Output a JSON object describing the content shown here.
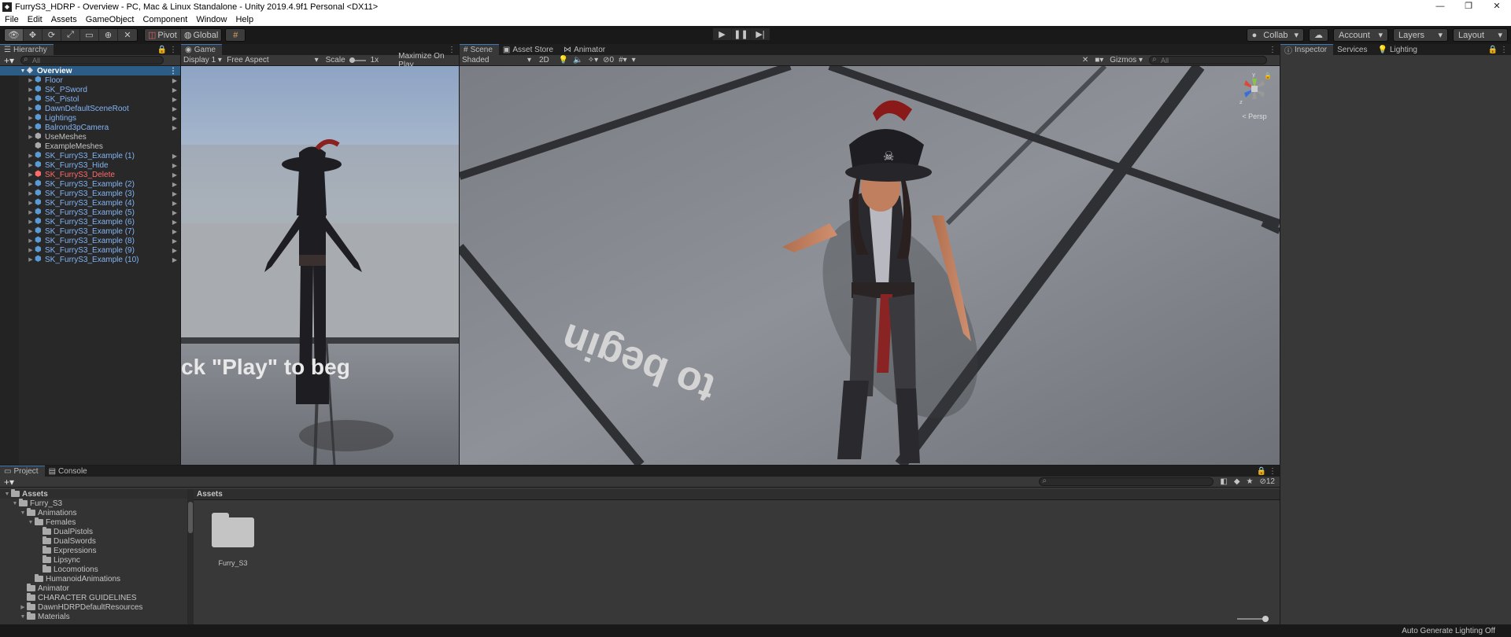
{
  "window": {
    "title": "FurryS3_HDRP - Overview - PC, Mac & Linux Standalone - Unity 2019.4.9f1 Personal <DX11>",
    "controls": [
      "—",
      "❐",
      "✕"
    ]
  },
  "menu": [
    "File",
    "Edit",
    "Assets",
    "GameObject",
    "Component",
    "Window",
    "Help"
  ],
  "toolbar": {
    "pivot": "Pivot",
    "global": "Global",
    "collab": "Collab",
    "account": "Account",
    "layers": "Layers",
    "layout": "Layout"
  },
  "hierarchy": {
    "tab": "Hierarchy",
    "search_placeholder": "All",
    "root": "Overview",
    "items": [
      {
        "label": "Floor",
        "style": "prefab"
      },
      {
        "label": "SK_PSword",
        "style": "prefab"
      },
      {
        "label": "SK_Pistol",
        "style": "prefab"
      },
      {
        "label": "DawnDefaultSceneRoot",
        "style": "prefab"
      },
      {
        "label": "Lightings",
        "style": "prefab"
      },
      {
        "label": "Balrond3pCamera",
        "style": "prefab"
      },
      {
        "label": "UseMeshes",
        "style": "plain"
      },
      {
        "label": "ExampleMeshes",
        "style": "plain"
      },
      {
        "label": "SK_FurryS3_Example (1)",
        "style": "prefab"
      },
      {
        "label": "SK_FurryS3_Hide",
        "style": "prefab"
      },
      {
        "label": "SK_FurryS3_Delete",
        "style": "red"
      },
      {
        "label": "SK_FurryS3_Example (2)",
        "style": "prefab"
      },
      {
        "label": "SK_FurryS3_Example (3)",
        "style": "prefab"
      },
      {
        "label": "SK_FurryS3_Example (4)",
        "style": "prefab"
      },
      {
        "label": "SK_FurryS3_Example (5)",
        "style": "prefab"
      },
      {
        "label": "SK_FurryS3_Example (6)",
        "style": "prefab"
      },
      {
        "label": "SK_FurryS3_Example (7)",
        "style": "prefab"
      },
      {
        "label": "SK_FurryS3_Example (8)",
        "style": "prefab"
      },
      {
        "label": "SK_FurryS3_Example (9)",
        "style": "prefab"
      },
      {
        "label": "SK_FurryS3_Example (10)",
        "style": "prefab"
      }
    ]
  },
  "game": {
    "tab": "Game",
    "display": "Display 1",
    "aspect": "Free Aspect",
    "scale_label": "Scale",
    "scale_value": "1x",
    "maximize": "Maximize On Play",
    "floor_text": "ck \"Play\" to beg"
  },
  "scene": {
    "tabs": [
      "Scene",
      "Asset Store",
      "Animator"
    ],
    "shading": "Shaded",
    "mode_2d": "2D",
    "hidden_count": "0",
    "gizmos": "Gizmos",
    "search_placeholder": "All",
    "persp": "< Persp",
    "axis_y": "y",
    "axis_z": "z",
    "floor_text": "to begin"
  },
  "inspector": {
    "tabs": [
      "Inspector",
      "Services",
      "Lighting"
    ]
  },
  "project": {
    "tabs": [
      "Project",
      "Console"
    ],
    "count": "12",
    "tree": [
      {
        "label": "Assets",
        "depth": 0,
        "open": true,
        "bold": true
      },
      {
        "label": "Furry_S3",
        "depth": 1,
        "open": true
      },
      {
        "label": "Animations",
        "depth": 2,
        "open": true
      },
      {
        "label": "Females",
        "depth": 3,
        "open": true
      },
      {
        "label": "DualPistols",
        "depth": 4,
        "open": false,
        "leaf": true
      },
      {
        "label": "DualSwords",
        "depth": 4,
        "open": false,
        "leaf": true
      },
      {
        "label": "Expressions",
        "depth": 4,
        "open": false,
        "leaf": true
      },
      {
        "label": "Lipsync",
        "depth": 4,
        "open": false,
        "leaf": true
      },
      {
        "label": "Locomotions",
        "depth": 4,
        "open": false,
        "leaf": true
      },
      {
        "label": "HumanoidAnimations",
        "depth": 3,
        "open": false,
        "leaf": true
      },
      {
        "label": "Animator",
        "depth": 2,
        "open": false,
        "leaf": true
      },
      {
        "label": "CHARACTER GUIDELINES",
        "depth": 2,
        "open": false,
        "leaf": true
      },
      {
        "label": "DawnHDRPDefaultResources",
        "depth": 2,
        "open": false
      },
      {
        "label": "Materials",
        "depth": 2,
        "open": true
      }
    ],
    "breadcrumb": "Assets",
    "folder_name": "Furry_S3"
  },
  "status": {
    "text": "Auto Generate Lighting Off"
  }
}
